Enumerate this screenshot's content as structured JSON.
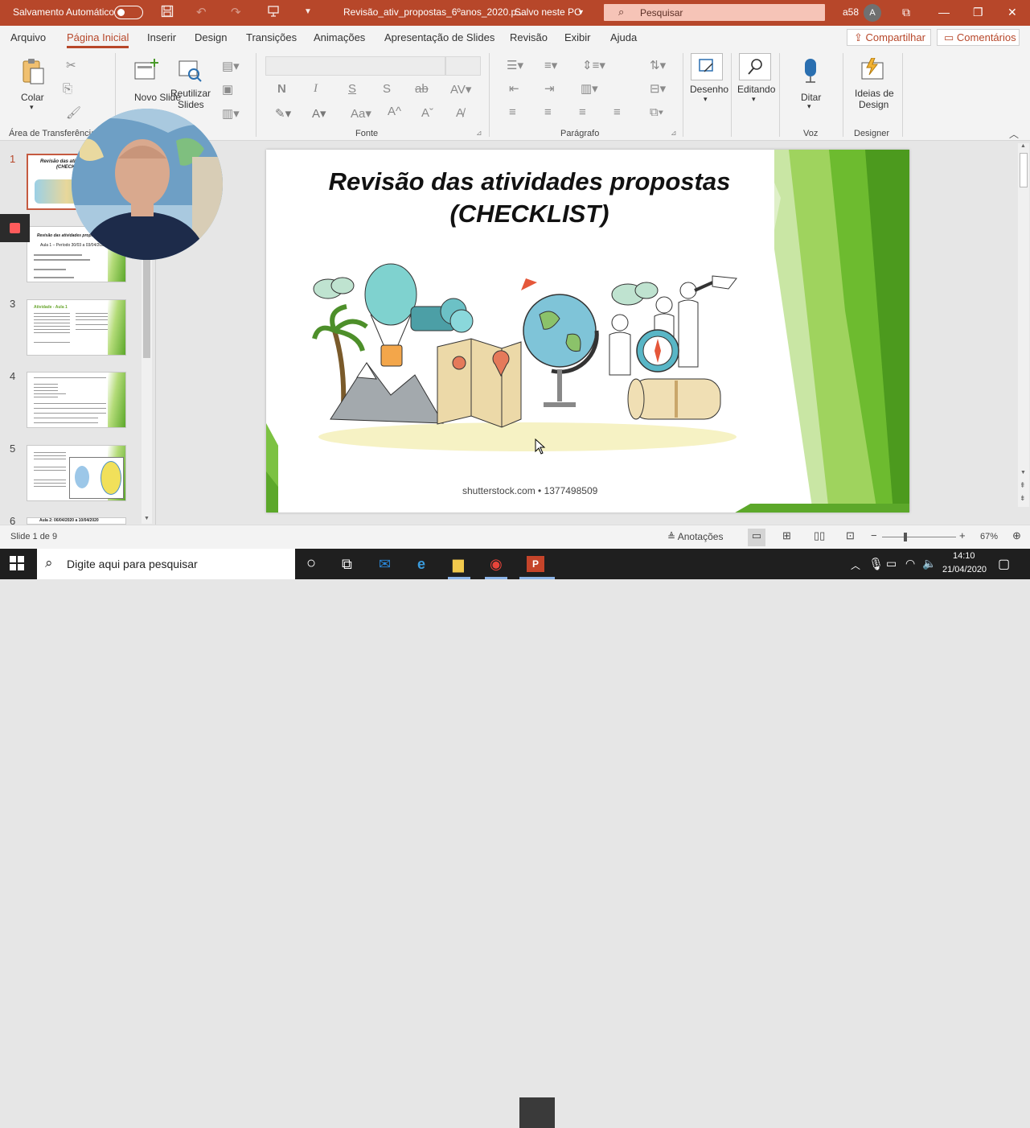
{
  "titlebar": {
    "autosave_label": "Salvamento Automático",
    "doc_title": "Revisão_ativ_propostas_6ºanos_2020.p...",
    "save_status": "Salvo neste PC",
    "search_placeholder": "Pesquisar",
    "user_code": "a58",
    "user_initial": "A"
  },
  "menu": {
    "tabs": [
      "Arquivo",
      "Página Inicial",
      "Inserir",
      "Design",
      "Transições",
      "Animações",
      "Apresentação de Slides",
      "Revisão",
      "Exibir",
      "Ajuda"
    ],
    "share": "Compartilhar",
    "comments": "Comentários"
  },
  "ribbon": {
    "paste": "Colar",
    "clipboard_group": "Área de Transferência",
    "new_slide": "Novo Slide",
    "reuse_slides_1": "Reutilizar",
    "reuse_slides_2": "Slides",
    "font_group": "Fonte",
    "paragraph_group": "Parágrafo",
    "draw": "Desenho",
    "editing": "Editando",
    "dictate": "Ditar",
    "voice_group": "Voz",
    "designer_1": "Ideias de",
    "designer_2": "Design",
    "designer_group": "Designer",
    "bold": "N",
    "italic": "I",
    "underline": "S",
    "shadow": "S"
  },
  "thumbnails": {
    "numbers": [
      "1",
      "2",
      "3",
      "4",
      "5",
      "6"
    ],
    "t1_title": "Revisão das atividades",
    "t1_sub": "(CHECKLIST)",
    "t2_title": "Revisão das atividades propostas",
    "t2_sub": "Aula 1 – Período 30/03 a 03/04/2020",
    "t3_title": "Atividade - Aula 1",
    "t6_title": "Aula 2: 06/04/2020 a 10/04/2020"
  },
  "slide": {
    "title_line1": "Revisão das atividades propostas",
    "title_line2": "(CHECKLIST)",
    "credit": "shutterstock.com • 1377498509"
  },
  "status": {
    "slide_counter": "Slide 1 de 9",
    "notes": "Anotações",
    "zoom": "67%"
  },
  "taskbar": {
    "search_placeholder": "Digite aqui para pesquisar",
    "time": "14:10",
    "date": "21/04/2020"
  },
  "colors": {
    "accent": "#b7472a",
    "slide_green": "#5ca82a"
  }
}
